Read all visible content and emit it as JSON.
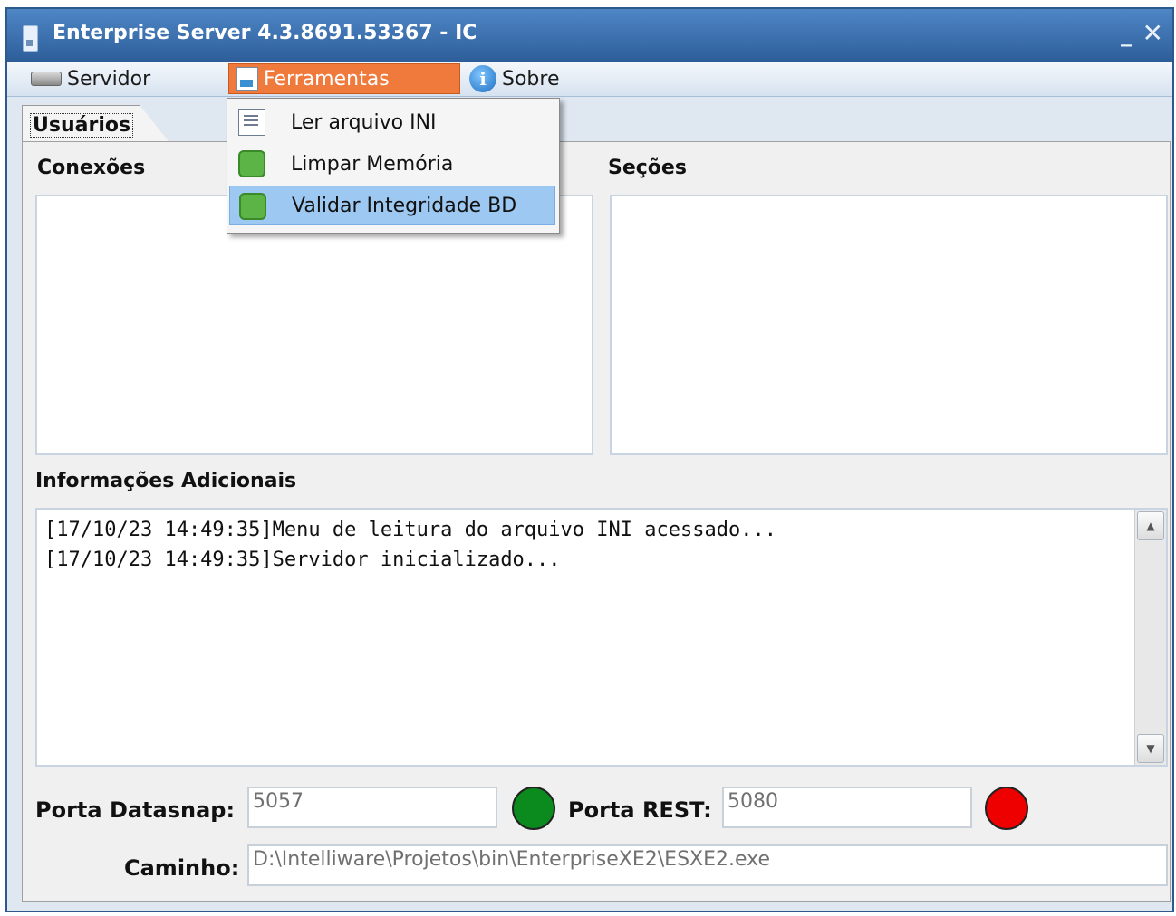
{
  "window": {
    "title": "Enterprise Server 4.3.8691.53367 - IC",
    "minimize_glyph": "_",
    "close_glyph": "✕"
  },
  "menubar": {
    "items": [
      {
        "label": "Servidor",
        "icon": "hdd-icon"
      },
      {
        "label": "Ferramentas",
        "icon": "tools-icon"
      },
      {
        "label": "Sobre",
        "icon": "info-icon"
      }
    ]
  },
  "dropdown": {
    "items": [
      {
        "label": "Ler arquivo INI",
        "icon": "document-icon"
      },
      {
        "label": "Limpar Memória",
        "icon": "puzzle-icon"
      },
      {
        "label": "Validar Integridade BD",
        "icon": "puzzle-icon"
      }
    ]
  },
  "tabs": [
    {
      "label": "Usuários"
    }
  ],
  "panel": {
    "connections_label": "Conexões",
    "sessions_label": "Seções",
    "info_label": "Informações Adicionais",
    "log_lines": [
      "[17/10/23 14:49:35]Menu de leitura do arquivo INI acessado...",
      "[17/10/23 14:49:35]Servidor inicializado..."
    ],
    "datasnap_label": "Porta Datasnap:",
    "datasnap_value": "5057",
    "rest_label": "Porta REST:",
    "rest_value": "5080",
    "path_label": "Caminho:",
    "path_value": "D:\\Intelliware\\Projetos\\bin\\EnterpriseXE2\\ESXE2.exe"
  },
  "colors": {
    "datasnap_status": "#0b8a1e",
    "rest_status": "#ee0000",
    "menu_active": "#f07a3c",
    "menu_highlight": "#9cc8f2"
  }
}
